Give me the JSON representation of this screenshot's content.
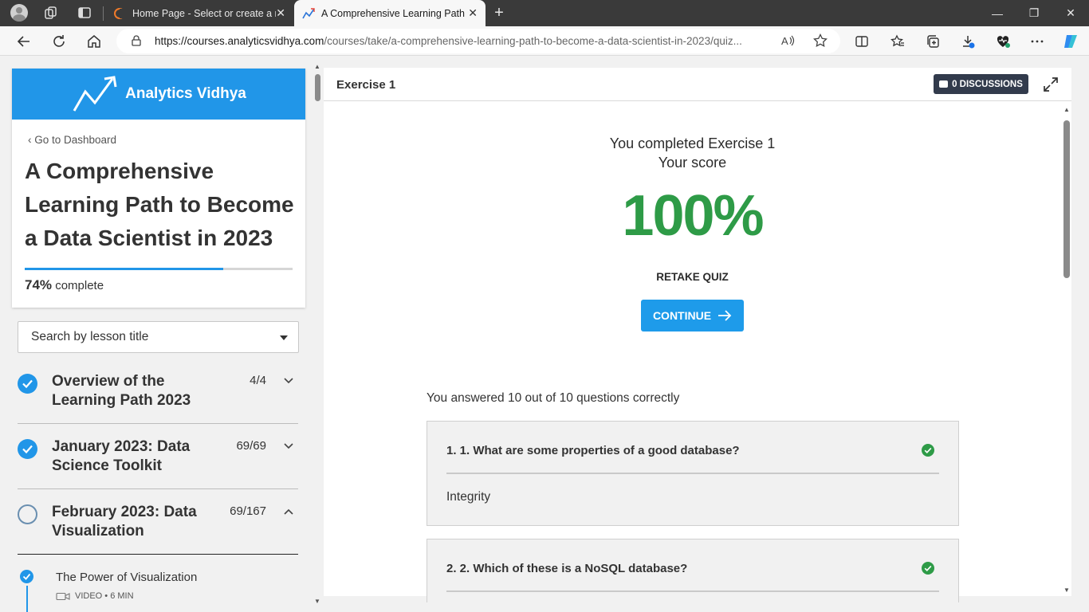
{
  "browser": {
    "tabs": [
      {
        "title": "Home Page - Select or create a n",
        "close": "✕"
      },
      {
        "title": "A Comprehensive Learning Path t",
        "close": "✕"
      }
    ],
    "new_tab": "+",
    "window": {
      "minimize": "—",
      "maximize": "❐",
      "close": "✕"
    },
    "url_host": "https://courses.analyticsvidhya.com",
    "url_path": "/courses/take/a-comprehensive-learning-path-to-become-a-data-scientist-in-2023/quiz..."
  },
  "sidebar": {
    "brand": "Analytics Vidhya",
    "dashboard_link": "Go to Dashboard",
    "course_title": "A Comprehensive Learning Path to Become a Data Scientist in 2023",
    "progress_percent": "74%",
    "progress_fraction": 0.74,
    "progress_suffix": "complete",
    "search_placeholder": "Search by lesson title",
    "sections": [
      {
        "title": "Overview of the Learning Path 2023",
        "count": "4/4",
        "status": "done"
      },
      {
        "title": "January 2023: Data Science Toolkit",
        "count": "69/69",
        "status": "done"
      },
      {
        "title": "February 2023: Data Visualization",
        "count": "69/167",
        "status": "open"
      }
    ],
    "lesson": {
      "title": "The Power of Visualization",
      "meta": "VIDEO • 6 MIN"
    }
  },
  "main": {
    "exercise_title": "Exercise 1",
    "discussions": "0 DISCUSSIONS",
    "completed_text": "You completed Exercise 1",
    "score_label": "Your score",
    "score": "100%",
    "retake": "RETAKE QUIZ",
    "continue": "CONTINUE",
    "answered": "You answered 10 out of 10 questions correctly",
    "questions": [
      {
        "text": "1. 1. What are some properties of a good database?",
        "answer": "Integrity"
      },
      {
        "text": "2. 2. Which of these is a NoSQL database?",
        "answer": ""
      }
    ]
  },
  "colors": {
    "accent": "#2196e8",
    "score_green": "#2e9b47",
    "dark_button": "#323b4c"
  }
}
